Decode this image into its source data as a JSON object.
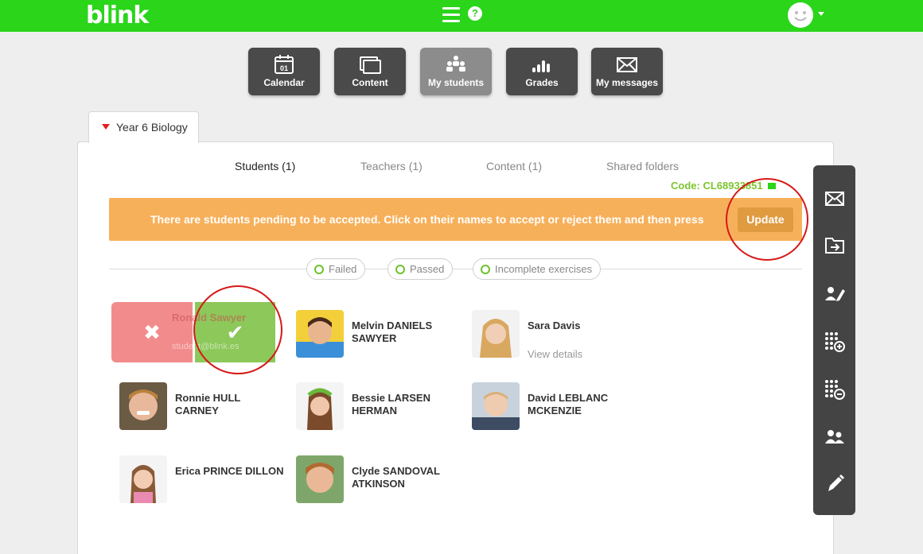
{
  "app": {
    "logo": "blink",
    "help": "?"
  },
  "nav": [
    {
      "label": "Calendar",
      "icon": "calendar-icon",
      "day": "01"
    },
    {
      "label": "Content",
      "icon": "content-icon"
    },
    {
      "label": "My students",
      "icon": "students-icon",
      "active": true
    },
    {
      "label": "Grades",
      "icon": "grades-icon"
    },
    {
      "label": "My messages",
      "icon": "envelope-icon"
    }
  ],
  "course": {
    "name": "Year 6 Biology"
  },
  "tabs": [
    {
      "label": "Students (1)",
      "active": true
    },
    {
      "label": "Teachers (1)"
    },
    {
      "label": "Content (1)"
    },
    {
      "label": "Shared folders"
    }
  ],
  "code": "Code: CL68933851",
  "banner": {
    "text": "There are students pending to be accepted. Click on their names to accept or reject them and then press",
    "button": "Update"
  },
  "filters": [
    "Failed",
    "Passed",
    "Incomplete exercises"
  ],
  "pending": {
    "name": "Ronald Sawyer",
    "email": "student@blink.es"
  },
  "students": [
    {
      "name": "Melvin DANIELS SAWYER"
    },
    {
      "name": "Sara Davis",
      "sub": "View details"
    },
    {
      "name": "Ronnie HULL CARNEY"
    },
    {
      "name": "Bessie LARSEN HERMAN"
    },
    {
      "name": "David LEBLANC MCKENZIE"
    },
    {
      "name": "Erica PRINCE DILLON"
    },
    {
      "name": "Clyde SANDOVAL ATKINSON"
    }
  ],
  "tools": [
    "envelope-icon",
    "folder-share-icon",
    "edit-user-icon",
    "add-grid-icon",
    "remove-grid-icon",
    "users-icon",
    "pencil-icon"
  ],
  "colors": {
    "brand": "#2ad51a",
    "banner": "#f7b05a",
    "accept": "#8dc85a",
    "reject": "#f28c8c",
    "code": "#7dc42f"
  }
}
